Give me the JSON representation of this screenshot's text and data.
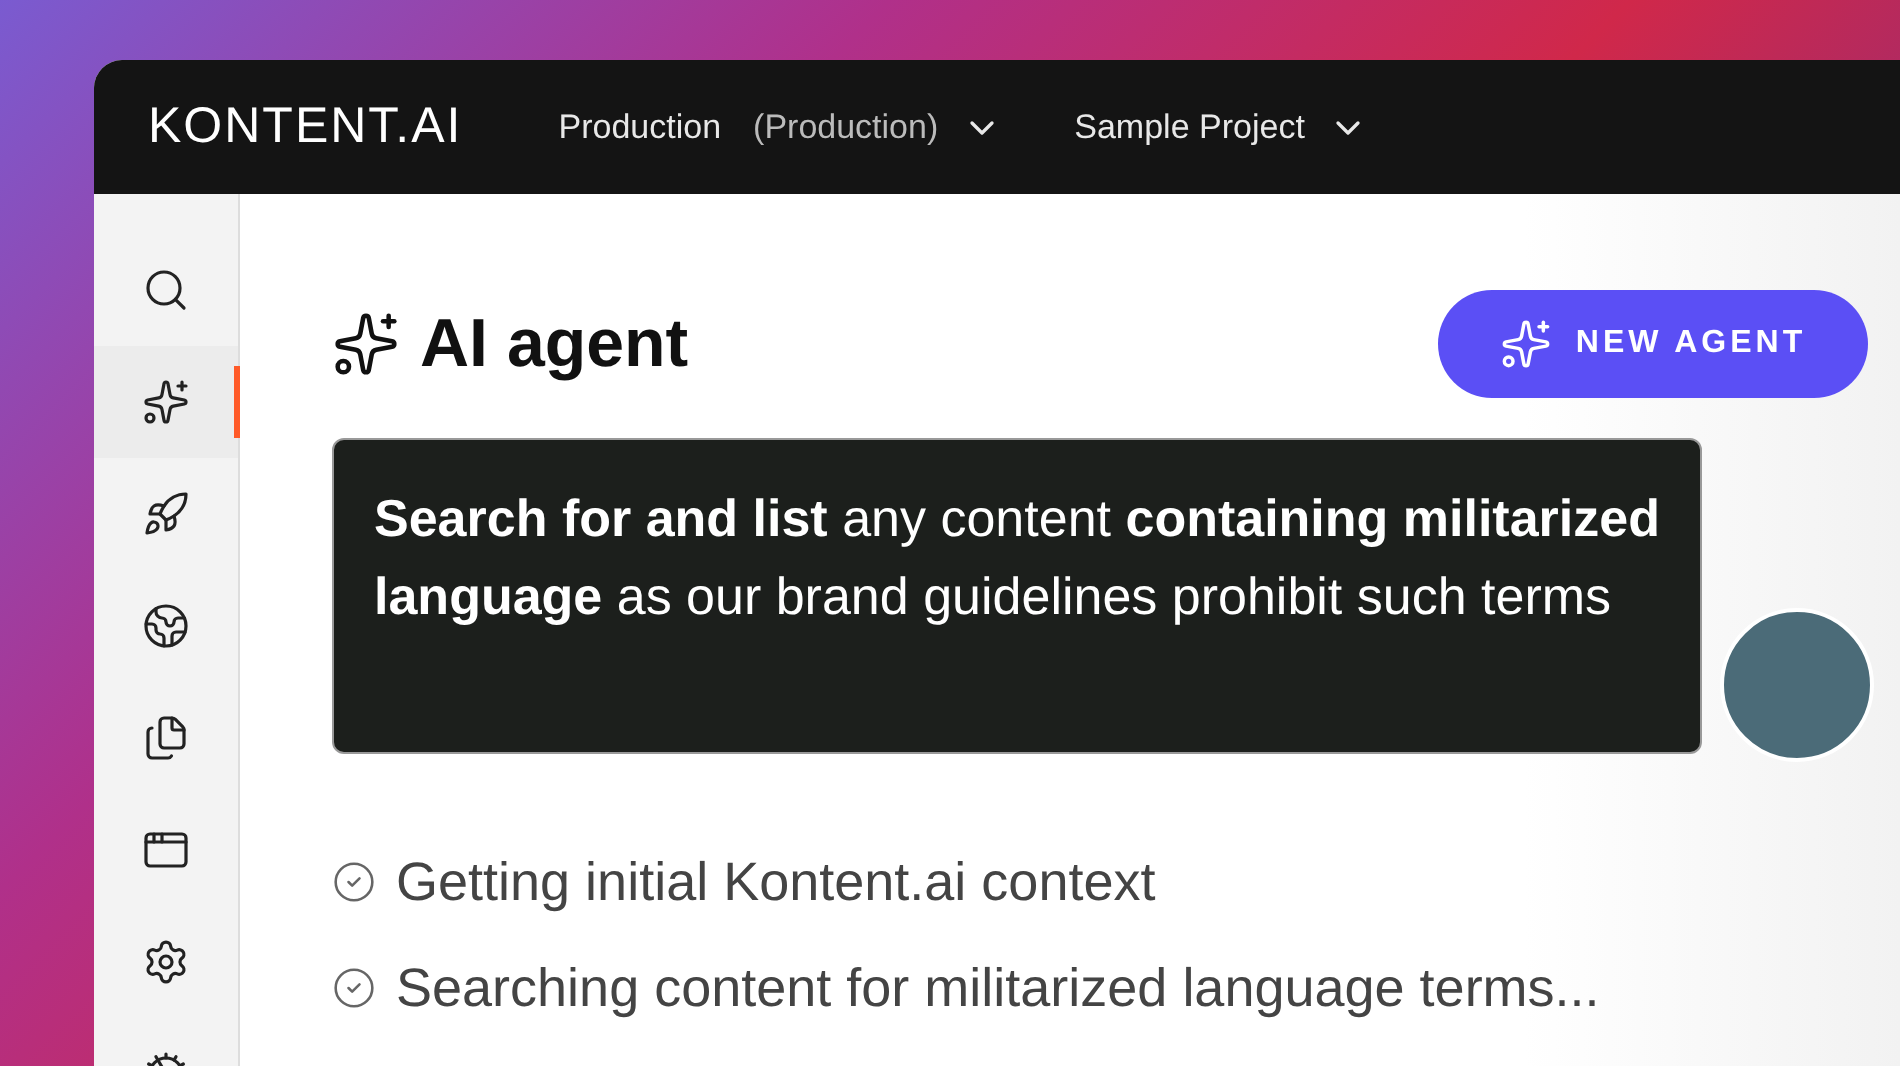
{
  "header": {
    "logo": "KONTENT.AI",
    "environment": {
      "name": "Production",
      "detail": "(Production)"
    },
    "project": "Sample Project"
  },
  "sidebar": {
    "items": [
      {
        "selected": false
      },
      {
        "selected": true
      },
      {
        "selected": false
      },
      {
        "selected": false
      },
      {
        "selected": false
      },
      {
        "selected": false
      },
      {
        "selected": false
      },
      {
        "selected": false
      }
    ]
  },
  "page": {
    "title": "AI agent",
    "new_button": "NEW AGENT"
  },
  "prompt": {
    "text": "**Search for and list** any content **containing militarized language** as our brand guidelines prohibit such terms"
  },
  "steps": [
    {
      "label": "Getting initial Kontent.ai context",
      "done": true
    },
    {
      "label": "Searching content for militarized language terms...",
      "done": true
    }
  ]
}
